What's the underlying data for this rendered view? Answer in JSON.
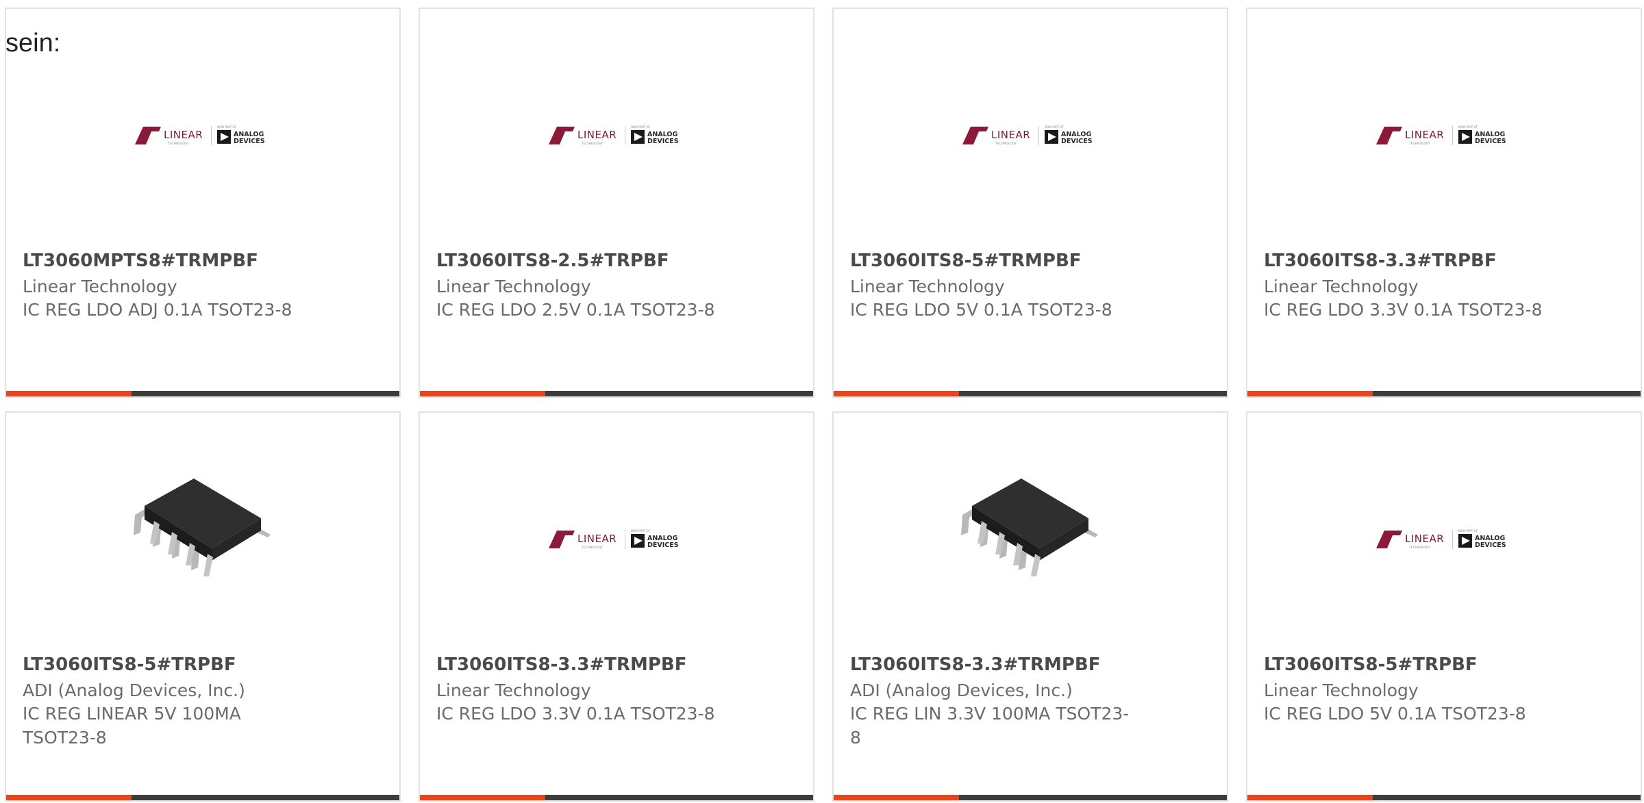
{
  "intro": "sein:",
  "logo": {
    "linear_word": "LINEAR",
    "linear_sub": "TECHNOLOGY",
    "now_part_of": "NOW PART OF",
    "analog_line1": "ANALOG",
    "analog_line2": "DEVICES"
  },
  "colors": {
    "accent": "#e8451c",
    "bar": "#3c3c3c",
    "border": "#e2e2e2",
    "title": "#4a4a4a",
    "text": "#6b6b6b",
    "linear_logo": "#8b1a3a"
  },
  "cards": [
    {
      "part": "LT3060MPTS8#TRMPBF",
      "manufacturer": "Linear Technology",
      "description": "IC REG LDO ADJ 0.1A TSOT23-8",
      "image": "linear-analog-logo"
    },
    {
      "part": "LT3060ITS8-2.5#TRPBF",
      "manufacturer": "Linear Technology",
      "description": "IC REG LDO 2.5V 0.1A TSOT23-8",
      "image": "linear-analog-logo"
    },
    {
      "part": "LT3060ITS8-5#TRMPBF",
      "manufacturer": "Linear Technology",
      "description": "IC REG LDO 5V 0.1A TSOT23-8",
      "image": "linear-analog-logo"
    },
    {
      "part": "LT3060ITS8-3.3#TRPBF",
      "manufacturer": "Linear Technology",
      "description": "IC REG LDO 3.3V 0.1A TSOT23-8",
      "image": "linear-analog-logo"
    },
    {
      "part": "LT3060ITS8-5#TRPBF",
      "manufacturer": "ADI (Analog Devices, Inc.)",
      "description": "IC REG LINEAR 5V 100MA TSOT23-8",
      "image": "ic-chip-photo"
    },
    {
      "part": "LT3060ITS8-3.3#TRMPBF",
      "manufacturer": "Linear Technology",
      "description": "IC REG LDO 3.3V 0.1A TSOT23-8",
      "image": "linear-analog-logo"
    },
    {
      "part": "LT3060ITS8-3.3#TRMPBF",
      "manufacturer": "ADI (Analog Devices, Inc.)",
      "description": "IC REG LIN 3.3V 100MA TSOT23-8",
      "image": "ic-chip-photo"
    },
    {
      "part": "LT3060ITS8-5#TRPBF",
      "manufacturer": "Linear Technology",
      "description": "IC REG LDO 5V 0.1A TSOT23-8",
      "image": "linear-analog-logo"
    }
  ]
}
